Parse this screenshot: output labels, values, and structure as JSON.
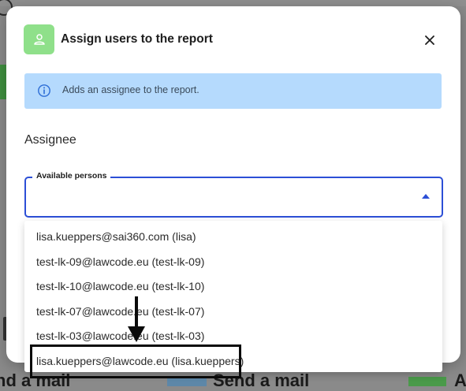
{
  "background": {
    "bottom_texts": [
      "nd a mail",
      "Send a mail",
      "A"
    ]
  },
  "dialog": {
    "title": "Assign users to the report",
    "title_icon": "person-icon",
    "close_icon": "close-icon",
    "info": {
      "icon": "info-icon",
      "text": "Adds an assignee to the report."
    },
    "section_label": "Assignee",
    "field": {
      "label": "Available persons",
      "value": "",
      "caret_icon": "caret-up-icon"
    },
    "options": [
      "lisa.kueppers@sai360.com (lisa)",
      "test-lk-09@lawcode.eu (test-lk-09)",
      "test-lk-10@lawcode.eu (test-lk-10)",
      "test-lk-07@lawcode.eu (test-lk-07)",
      "test-lk-03@lawcode.eu (test-lk-03)",
      "lisa.kueppers@lawcode.eu (lisa.kueppers)"
    ],
    "highlighted_option_index": 5
  },
  "colors": {
    "accent_blue": "#2c4fd6",
    "info_banner": "#b5dafd",
    "title_icon_bg": "#8fe08a"
  }
}
